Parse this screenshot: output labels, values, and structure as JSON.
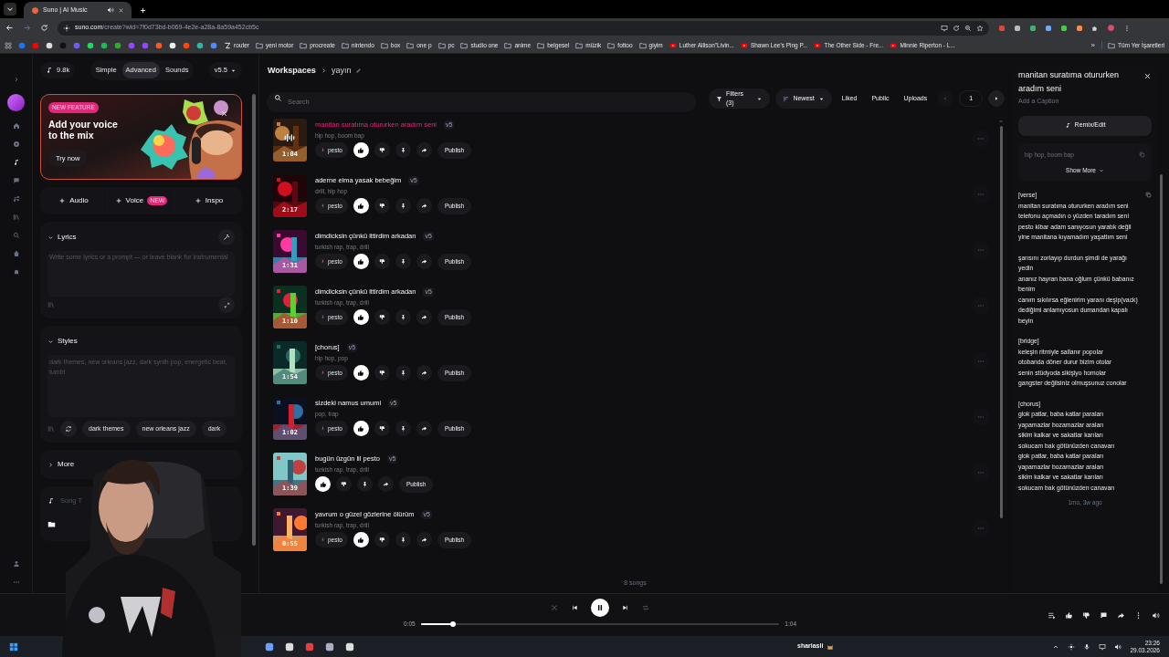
{
  "browser": {
    "tab_title": "Suno | AI Music",
    "url_host": "suno.com",
    "url_path": "/create?wid=7f0d73bd-b069-4e2e-a28a-8a59a452cb5c",
    "bookmarks": [
      {
        "kind": "icon"
      },
      {
        "kind": "icon"
      },
      {
        "kind": "icon"
      },
      {
        "kind": "icon"
      },
      {
        "kind": "icon"
      },
      {
        "kind": "icon"
      },
      {
        "kind": "icon"
      },
      {
        "kind": "icon"
      },
      {
        "kind": "icon"
      },
      {
        "kind": "icon"
      },
      {
        "kind": "icon"
      },
      {
        "kind": "icon"
      },
      {
        "kind": "icon"
      },
      {
        "kind": "icon"
      },
      {
        "kind": "icon"
      },
      {
        "kind": "site",
        "label": "router"
      },
      {
        "kind": "folder",
        "label": "yeni motor"
      },
      {
        "kind": "folder",
        "label": "procreate"
      },
      {
        "kind": "folder",
        "label": "nintendo"
      },
      {
        "kind": "folder",
        "label": "box"
      },
      {
        "kind": "folder",
        "label": "one p"
      },
      {
        "kind": "folder",
        "label": "pc"
      },
      {
        "kind": "folder",
        "label": "studio one"
      },
      {
        "kind": "folder",
        "label": "anime"
      },
      {
        "kind": "folder",
        "label": "belgesel"
      },
      {
        "kind": "folder",
        "label": "müzik"
      },
      {
        "kind": "folder",
        "label": "fottoo"
      },
      {
        "kind": "folder",
        "label": "giyim"
      },
      {
        "kind": "video",
        "label": "Luther Allison\"Livin..."
      },
      {
        "kind": "video",
        "label": "Shawn Lee's Ping P..."
      },
      {
        "kind": "video",
        "label": "The Other Side - Fre..."
      },
      {
        "kind": "video",
        "label": "Minnie Riperton - L..."
      }
    ],
    "more_bookmarks": "»",
    "all_bookmarks": "Tüm Yer İşaretleri"
  },
  "create_panel": {
    "credits": "9.8k",
    "modes": [
      {
        "label": "Simple",
        "selected": false
      },
      {
        "label": "Advanced",
        "selected": true
      },
      {
        "label": "Sounds",
        "selected": false
      }
    ],
    "model": "v5.5",
    "banner": {
      "badge": "NEW FEATURE",
      "title": "Add your voice to the mix",
      "button": "Try now"
    },
    "add_buttons": [
      {
        "label": "Audio"
      },
      {
        "label": "Voice",
        "badge": "NEW"
      },
      {
        "label": "Inspo"
      }
    ],
    "lyrics": {
      "label": "Lyrics",
      "placeholder": "Write some lyrics or a prompt — or leave blank for instrumental"
    },
    "styles": {
      "label": "Styles",
      "placeholder": "dark themes, new orleans jazz, dark synth pop, energetic beat, tumbl",
      "chips": [
        "dark themes",
        "new orleans jazz",
        "dark"
      ]
    },
    "more": "More",
    "song_title_placeholder": "Song T"
  },
  "workspace": {
    "breadcrumb_root": "Workspaces",
    "breadcrumb_current": "yayın",
    "search_placeholder": "Search",
    "filters": "Filters (3)",
    "sort": "Newest",
    "toggles": [
      "Liked",
      "Public",
      "Uploads"
    ],
    "page": "1",
    "songs": [
      {
        "title": "manitan suratıma otururken aradım seni",
        "version": "v5",
        "tags": "hip hop, boom bap",
        "duration": "1:04",
        "playing": true,
        "persona": "pesto",
        "publish": "Publish"
      },
      {
        "title": "aderne elma yasak bebeğim",
        "version": "v5",
        "tags": "drill, hip hop",
        "duration": "2:17",
        "playing": false,
        "persona": "pesto",
        "publish": "Publish"
      },
      {
        "title": "dimdicksin çünkü ittirdim arkadan",
        "version": "v5",
        "tags": "turkish rap, trap, drill",
        "duration": "1:31",
        "playing": false,
        "persona": "pesto",
        "publish": "Publish"
      },
      {
        "title": "dimdicksin çünkü ittirdim arkadan",
        "version": "v5",
        "tags": "turkish rap, trap, drill",
        "duration": "1:10",
        "playing": false,
        "persona": "pesto",
        "publish": "Publish"
      },
      {
        "title": "[chorus]",
        "version": "v5",
        "tags": "hip hop, pop",
        "duration": "1:54",
        "playing": false,
        "persona": "pesto",
        "publish": "Publish"
      },
      {
        "title": "sizdeki namus umumi",
        "version": "v5",
        "tags": "pop, trap",
        "duration": "1:02",
        "playing": false,
        "persona": "pesto",
        "publish": "Publish"
      },
      {
        "title": "bugün üzgün lil pesto",
        "version": "v5",
        "tags": "turkish rap, trap, drill",
        "duration": "1:39",
        "playing": false,
        "publish": "Publish"
      },
      {
        "title": "yavrum o güzel gözlerine ölürüm",
        "version": "v5",
        "tags": "turkish rap, trap, drill",
        "duration": "0:55",
        "playing": false,
        "persona": "pesto",
        "publish": "Publish"
      }
    ],
    "count": "8 songs"
  },
  "detail": {
    "title": "manitan suratıma otururken aradım seni",
    "caption_placeholder": "Add a Caption",
    "remix": "Remix/Edit",
    "tags": "hip hop, boom bap",
    "show_more": "Show More",
    "lyrics": [
      [
        "[verse]",
        "manitan suratıma otururken aradım seni",
        "telefonu açmadın o yüzden taradım seni",
        "pesto kibar adam sanıyosun yaratık değil",
        "yine manitana kıyamadım yaşattım seni"
      ],
      [
        "şarısını zorlayıp durdun şimdi de yarağı yedin",
        "ananız hayran bana oğlum çünkü babanız benim",
        "canım sıkılırsa eğlenirim yaranı deşip(vack)",
        "dediğimi anlamıyosun dumandan kapalı beyin"
      ],
      [
        "[bridge]",
        "keleşin ritmiyle sallanır popolar",
        "otobanda döner durur bizim otolar",
        "senin stüdyoda sikişiyo homolar",
        "gangster değilsiniz olmuşsunuz conolar"
      ],
      [
        "[chorus]",
        "glok patlar, baba katlar paraları",
        "yapamazlar bozamazlar araları",
        "sikim kalkar ve sakatlar karıları",
        "sokucam bak götünüzden canavarı",
        "glok patlar, baba katlar paraları",
        "yapamazlar bozamazlar araları",
        "sikim kalkar ve sakatlar karıları",
        "sokucam bak götünüzden canavarı"
      ]
    ],
    "age": "1mo, 3w ago"
  },
  "player": {
    "elapsed": "0:05",
    "total": "1:04",
    "level": 0.09,
    "playing": true
  },
  "taskbar": {
    "user": "shariasli",
    "time": "23:26",
    "date": "29.03.2026"
  }
}
